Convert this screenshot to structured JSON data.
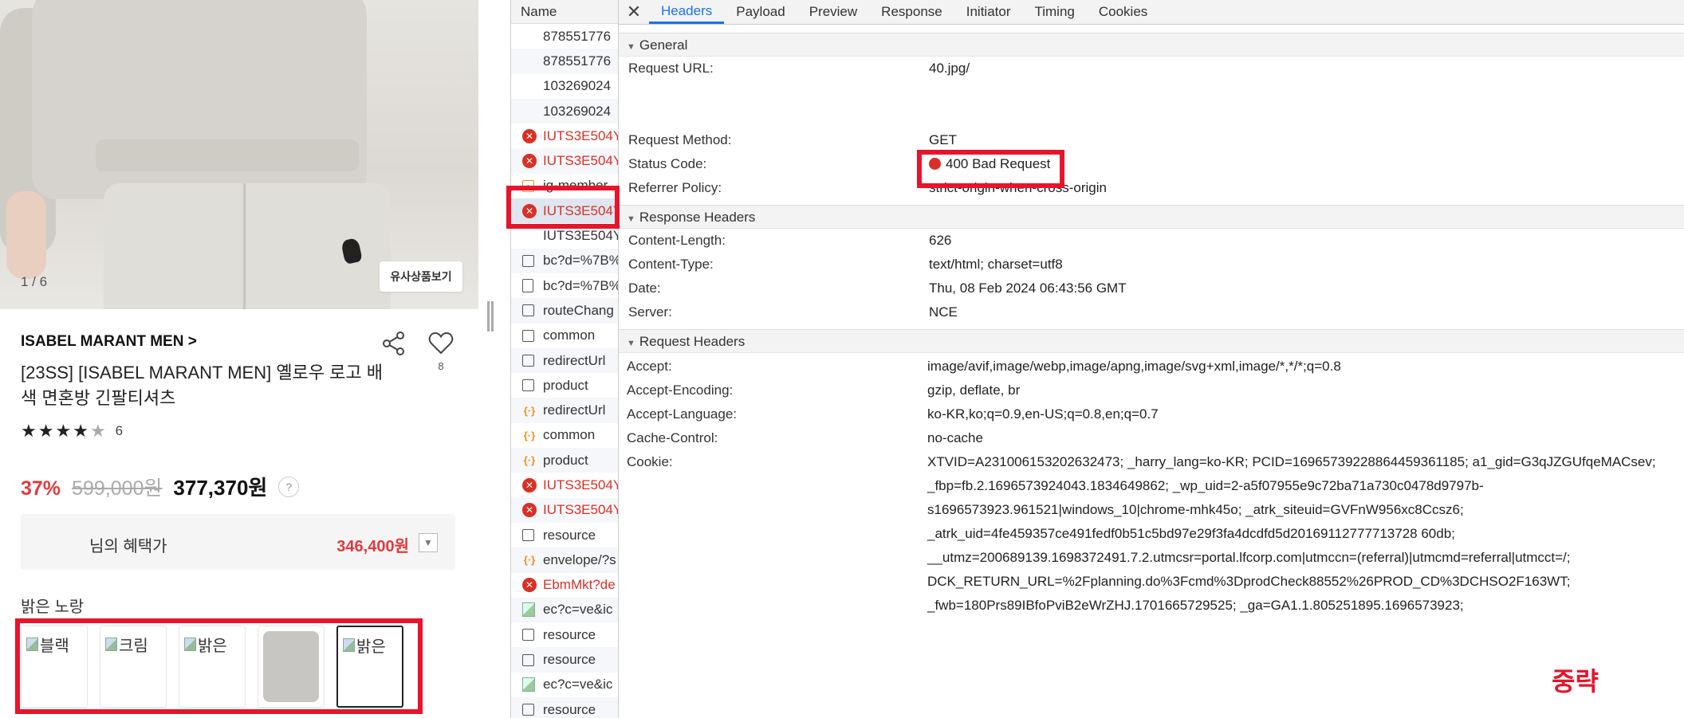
{
  "product": {
    "photo_counter": "1 / 6",
    "similar_button": "유사상품보기",
    "brand": "ISABEL MARANT MEN >",
    "like_count": "8",
    "title": "[23SS] [ISABEL MARANT MEN] 옐로우 로고 배색 면혼방 긴팔티셔츠",
    "rating_stars": 4,
    "review_count": "6",
    "discount": "37%",
    "original_price": "599,000원",
    "sale_price": "377,370원",
    "help_glyph": "?",
    "benefit_label": "님의 혜택가",
    "benefit_price": "346,400원",
    "color_label": "밝은 노랑",
    "swatches": [
      {
        "alt": "블랙"
      },
      {
        "alt": "크림"
      },
      {
        "alt": "밝은"
      },
      {
        "alt": ""
      },
      {
        "alt": "밝은"
      }
    ]
  },
  "network": {
    "name_header": "Name",
    "requests": [
      {
        "name": "878551776",
        "icon": "none",
        "error": false
      },
      {
        "name": "878551776",
        "icon": "none",
        "error": false
      },
      {
        "name": "103269024",
        "icon": "none",
        "error": false
      },
      {
        "name": "103269024",
        "icon": "none",
        "error": false
      },
      {
        "name": "IUTS3E504Y",
        "icon": "err",
        "error": true
      },
      {
        "name": "IUTS3E504Y",
        "icon": "err",
        "error": true
      },
      {
        "name": "ig-member",
        "icon": "mini",
        "error": false
      },
      {
        "name": "IUTS3E504Y",
        "icon": "err",
        "error": true
      },
      {
        "name": "IUTS3E504Y",
        "icon": "none",
        "error": false
      },
      {
        "name": "bc?d=%7B%",
        "icon": "box",
        "error": false
      },
      {
        "name": "bc?d=%7B%",
        "icon": "doc",
        "error": false
      },
      {
        "name": "routeChang",
        "icon": "box",
        "error": false
      },
      {
        "name": "common",
        "icon": "box",
        "error": false
      },
      {
        "name": "redirectUrl",
        "icon": "box",
        "error": false
      },
      {
        "name": "product",
        "icon": "box",
        "error": false
      },
      {
        "name": "redirectUrl",
        "icon": "fetch",
        "error": false
      },
      {
        "name": "common",
        "icon": "fetch",
        "error": false
      },
      {
        "name": "product",
        "icon": "fetch",
        "error": false
      },
      {
        "name": "IUTS3E504Y",
        "icon": "err",
        "error": true
      },
      {
        "name": "IUTS3E504Y",
        "icon": "err",
        "error": true
      },
      {
        "name": "resource",
        "icon": "box",
        "error": false
      },
      {
        "name": "envelope/?s",
        "icon": "fetch",
        "error": false
      },
      {
        "name": "EbmMkt?de",
        "icon": "err",
        "error": true
      },
      {
        "name": "ec?c=ve&ic",
        "icon": "img",
        "error": false
      },
      {
        "name": "resource",
        "icon": "box",
        "error": false
      },
      {
        "name": "resource",
        "icon": "box",
        "error": false
      },
      {
        "name": "ec?c=ve&ic",
        "icon": "img",
        "error": false
      },
      {
        "name": "resource",
        "icon": "box",
        "error": false
      }
    ],
    "tabs": [
      "Headers",
      "Payload",
      "Preview",
      "Response",
      "Initiator",
      "Timing",
      "Cookies"
    ],
    "active_tab": "Headers",
    "close_glyph": "✕",
    "general": {
      "title": "General",
      "request_url_key": "Request URL:",
      "request_url_value": "40.jpg/",
      "request_method_key": "Request Method:",
      "request_method_value": "GET",
      "status_code_key": "Status Code:",
      "status_code_value": "400 Bad Request",
      "referrer_policy_key": "Referrer Policy:",
      "referrer_policy_value": "strict-origin-when-cross-origin"
    },
    "response_headers": {
      "title": "Response Headers",
      "rows": [
        {
          "k": "Content-Length:",
          "v": "626"
        },
        {
          "k": "Content-Type:",
          "v": "text/html; charset=utf8"
        },
        {
          "k": "Date:",
          "v": "Thu, 08 Feb 2024 06:43:56 GMT"
        },
        {
          "k": "Server:",
          "v": "NCE"
        }
      ]
    },
    "request_headers": {
      "title": "Request Headers",
      "rows": [
        {
          "k": "Accept:",
          "v": "image/avif,image/webp,image/apng,image/svg+xml,image/*,*/*;q=0.8"
        },
        {
          "k": "Accept-Encoding:",
          "v": "gzip, deflate, br"
        },
        {
          "k": "Accept-Language:",
          "v": "ko-KR,ko;q=0.9,en-US;q=0.8,en;q=0.7"
        },
        {
          "k": "Cache-Control:",
          "v": "no-cache"
        }
      ],
      "cookie_key": "Cookie:",
      "cookie_lines": [
        "XTVID=A231006153202632473; _harry_lang=ko-KR; PCID=16965739228864459361185; a1_gid=G3qJZGUfqeMACsev;",
        "_fbp=fb.2.1696573924043.1834649862; _wp_uid=2-a5f07955e9c72ba71a730c0478d9797b-",
        "s1696573923.961521|windows_10|chrome-mhk45o; _atrk_siteuid=GVFnW956xc8Ccsz6;",
        "_atrk_uid=4fe459357ce491fedf0b51c5bd97e29f3fa4dcdfd5d20169112777713728 60db;",
        "__utmz=200689139.1698372491.7.2.utmcsr=portal.lfcorp.com|utmccn=(referral)|utmcmd=referral|utmcct=/;",
        "DCK_RETURN_URL=%2Fplanning.do%3Fcmd%3DprodCheck88552%26PROD_CD%3DCHSO2F163WT;",
        "_fwb=180Prs89IBfoPviB2eWrZHJ.1701665729525; _ga=GA1.1.805251895.1696573923;"
      ]
    },
    "omitted_note": "중략"
  },
  "colors": {
    "accent_red": "#e8142c",
    "tab_blue": "#1a73e8",
    "price_red": "#e03a3e"
  }
}
